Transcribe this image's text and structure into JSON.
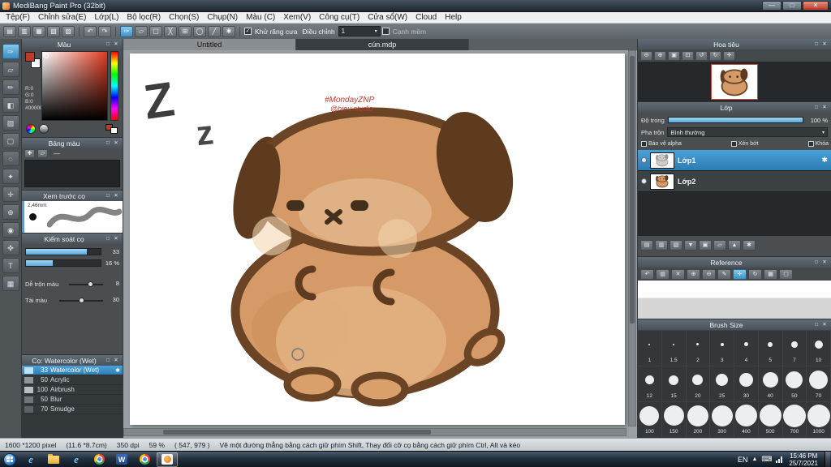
{
  "ui": {
    "caret": "▾",
    "popout": "□",
    "close": "✕",
    "gear": "✱",
    "check": "✓"
  },
  "window": {
    "title": "MediBang Paint Pro (32bit)",
    "minimize": "—",
    "maximize": "□",
    "close": "✕"
  },
  "menu": {
    "items": [
      "Tệp(F)",
      "Chỉnh sửa(E)",
      "Lớp(L)",
      "Bộ lọc(R)",
      "Chọn(S)",
      "Chụp(N)",
      "Màu (C)",
      "Xem(V)",
      "Công cụ(T)",
      "Cửa sổ(W)",
      "Cloud",
      "Help"
    ]
  },
  "toolbar": {
    "icons": [
      {
        "name": "new",
        "glyph": "▤"
      },
      {
        "name": "open",
        "glyph": "▥"
      },
      {
        "name": "save",
        "glyph": "▦"
      },
      {
        "name": "export",
        "glyph": "▧"
      },
      {
        "name": "print",
        "glyph": "▨"
      },
      {
        "name": "undo",
        "glyph": "↶"
      },
      {
        "name": "redo",
        "glyph": "↷"
      },
      {
        "name": "brush-mode",
        "glyph": "✑"
      },
      {
        "name": "eraser-mode",
        "glyph": "▱"
      },
      {
        "name": "select",
        "glyph": "▢"
      },
      {
        "name": "deselect",
        "glyph": "╳"
      },
      {
        "name": "snap-grid",
        "glyph": "⊞"
      },
      {
        "name": "snap-circle",
        "glyph": "◯"
      },
      {
        "name": "snap-line",
        "glyph": "╱"
      },
      {
        "name": "snap-settings",
        "glyph": "✱"
      }
    ],
    "antialias_label": "Khử răng cưa",
    "correction_label": "Điều chỉnh",
    "correction_value": "1",
    "soft_edge_label": "Cạnh mềm"
  },
  "tools": {
    "items": [
      {
        "name": "brush",
        "glyph": "✑"
      },
      {
        "name": "eraser",
        "glyph": "▱"
      },
      {
        "name": "pen",
        "glyph": "✏"
      },
      {
        "name": "fill",
        "glyph": "◧"
      },
      {
        "name": "gradient",
        "glyph": "▨"
      },
      {
        "name": "select",
        "glyph": "▢"
      },
      {
        "name": "lasso",
        "glyph": "◌"
      },
      {
        "name": "magic-wand",
        "glyph": "✦"
      },
      {
        "name": "move",
        "glyph": "✛"
      },
      {
        "name": "zoom",
        "glyph": "⊕"
      },
      {
        "name": "eyedropper",
        "glyph": "◉"
      },
      {
        "name": "hand",
        "glyph": "✜"
      },
      {
        "name": "text",
        "glyph": "T"
      },
      {
        "name": "divide",
        "glyph": "▦"
      }
    ]
  },
  "tabs": {
    "tab1": "Untitled",
    "tab2": "cún.mdp"
  },
  "canvas": {
    "z_big": "Z",
    "z_small": "z",
    "signature_line1": "#MondayZNP",
    "signature_line2": "@hieu.studio"
  },
  "color_panel": {
    "title": "Màu",
    "r": "R:0",
    "g": "G:0",
    "b": "B:0",
    "hex": "#000000"
  },
  "palette_panel": {
    "title": "Bảng màu",
    "dash": "—",
    "icons": [
      {
        "name": "add-color",
        "glyph": "✚"
      },
      {
        "name": "delete-color",
        "glyph": "▱"
      }
    ]
  },
  "preview_panel": {
    "title": "Xem trước cọ",
    "size": "2,46mm"
  },
  "control_panel": {
    "title": "Kiểm soát cọ",
    "slider1_value": "33",
    "slider2_value": "16 %",
    "mix_label": "Dễ trộn màu",
    "mix_value": "8",
    "load_label": "Tải màu",
    "load_value": "30"
  },
  "brush_panel": {
    "title": "Cọ: Watercolor (Wet)",
    "brushes": [
      {
        "num": "33",
        "name": "Watercolor (Wet)"
      },
      {
        "num": "50",
        "name": "Acrylic"
      },
      {
        "num": "100",
        "name": "Airbrush"
      },
      {
        "num": "50",
        "name": "Blur"
      },
      {
        "num": "70",
        "name": "Smudge"
      }
    ]
  },
  "navigator": {
    "title": "Hoa tiêu",
    "icons": [
      {
        "name": "zoom-out",
        "glyph": "⊖"
      },
      {
        "name": "zoom-in",
        "glyph": "⊕"
      },
      {
        "name": "fit",
        "glyph": "▣"
      },
      {
        "name": "actual-size",
        "glyph": "⊡"
      },
      {
        "name": "rotate-left",
        "glyph": "↺"
      },
      {
        "name": "rotate-right",
        "glyph": "↻"
      },
      {
        "name": "reset",
        "glyph": "✛"
      }
    ]
  },
  "layer_panel": {
    "title": "Lớp",
    "opacity_label": "Độ trong",
    "opacity_value": "100 %",
    "blend_label": "Pha trộn",
    "blend_value": "Bình thường",
    "cb_alpha": "Bảo vệ alpha",
    "cb_clip": "Xén bớt",
    "cb_lock": "Khóa",
    "layers": [
      {
        "name": "Lớp1"
      },
      {
        "name": "Lớp2"
      }
    ],
    "tools": [
      {
        "name": "new-layer",
        "glyph": "▤"
      },
      {
        "name": "new-folder",
        "glyph": "▥"
      },
      {
        "name": "duplicate",
        "glyph": "▧"
      },
      {
        "name": "merge-down",
        "glyph": "▼"
      },
      {
        "name": "clear",
        "glyph": "▣"
      },
      {
        "name": "delete",
        "glyph": "▱"
      },
      {
        "name": "move-up",
        "glyph": "▲"
      },
      {
        "name": "settings",
        "glyph": "✱"
      }
    ]
  },
  "reference_panel": {
    "title": "Reference",
    "icons": [
      {
        "name": "back",
        "glyph": "↶"
      },
      {
        "name": "open",
        "glyph": "▥"
      },
      {
        "name": "close-image",
        "glyph": "✕"
      },
      {
        "name": "zoom-in",
        "glyph": "⊕"
      },
      {
        "name": "zoom-out",
        "glyph": "⊖"
      },
      {
        "name": "pick",
        "glyph": "✎"
      },
      {
        "name": "hand",
        "glyph": "✛"
      },
      {
        "name": "rotate",
        "glyph": "↻"
      },
      {
        "name": "grid",
        "glyph": "▦"
      },
      {
        "name": "detach",
        "glyph": "▢"
      }
    ]
  },
  "brush_size_panel": {
    "title": "Brush Size",
    "sizes": [
      "1",
      "1.5",
      "2",
      "3",
      "4",
      "5",
      "7",
      "10",
      "12",
      "15",
      "20",
      "25",
      "30",
      "40",
      "50",
      "70",
      "100",
      "150",
      "200",
      "300",
      "400",
      "500",
      "700",
      "1000"
    ]
  },
  "status": {
    "dimensions": "1600 *1200 pixel",
    "physical": "(11.6 *8.7cm)",
    "dpi": "350 dpi",
    "zoom": "59 %",
    "coords": "( 547, 979 )",
    "hint": "Vẽ một đường thẳng bằng cách giữ phím Shift, Thay đổi cỡ cọ bằng cách giữ phím Ctrl, Alt và kéo"
  },
  "taskbar": {
    "lang": "EN",
    "time": "15:46 PM",
    "date": "25/7/2021",
    "ie_glyph": "e",
    "word_glyph": "W"
  }
}
